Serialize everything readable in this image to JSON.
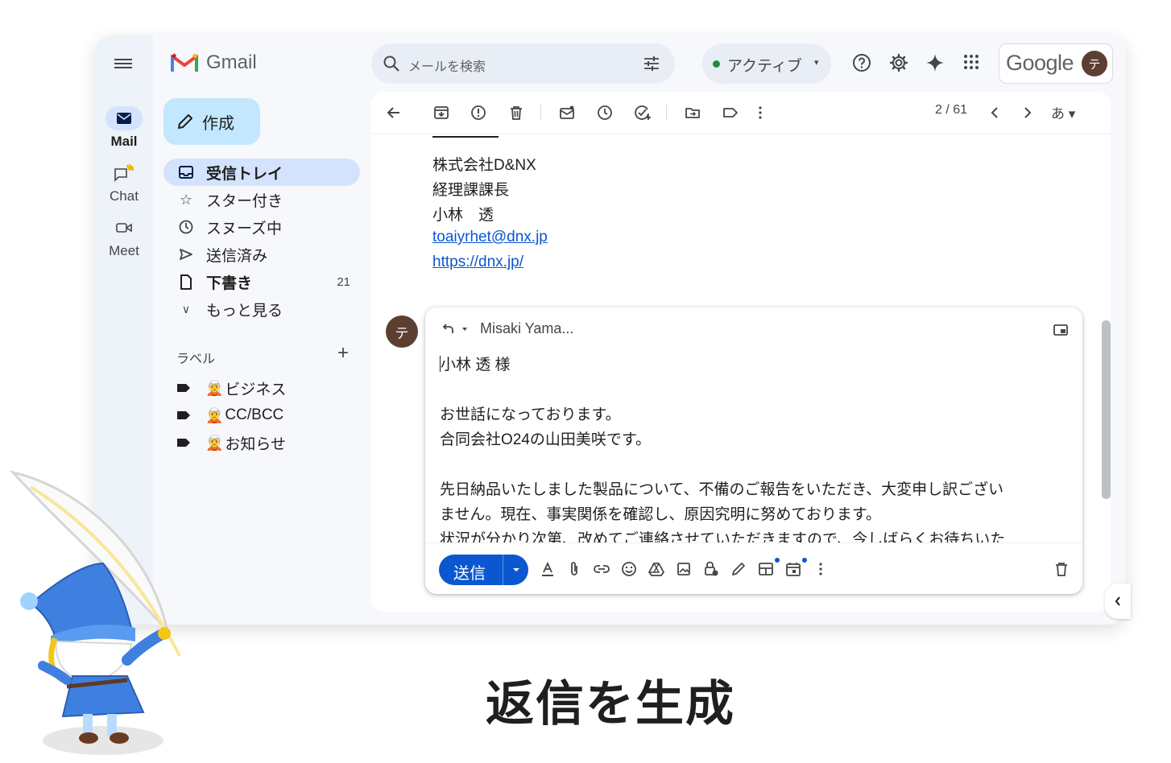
{
  "app": {
    "name": "Gmail",
    "brand_colors": {
      "blue": "#0b57d0",
      "compose": "#c2e7ff",
      "nav_active": "#d3e3fd",
      "avatar": "#5d3f32"
    }
  },
  "rail": {
    "items": [
      {
        "label": "Mail",
        "icon": "mail-icon",
        "active": true
      },
      {
        "label": "Chat",
        "icon": "chat-icon"
      },
      {
        "label": "Meet",
        "icon": "video-icon"
      }
    ]
  },
  "search": {
    "placeholder": "メールを検索"
  },
  "status": {
    "label": "アクティブ"
  },
  "account": {
    "brand": "Google",
    "initial": "テ"
  },
  "compose": {
    "label": "作成"
  },
  "nav": {
    "items": [
      {
        "label": "受信トレイ",
        "icon": "inbox-icon"
      },
      {
        "label": "スター付き",
        "icon": "star-icon"
      },
      {
        "label": "スヌーズ中",
        "icon": "clock-icon"
      },
      {
        "label": "送信済み",
        "icon": "send-icon"
      },
      {
        "label": "下書き",
        "icon": "draft-icon",
        "count": "21"
      },
      {
        "label": "もっと見る",
        "icon": "chevron-down-icon"
      }
    ]
  },
  "labels": {
    "heading": "ラベル",
    "items": [
      {
        "name": "ビジネス",
        "emoji": "🧝"
      },
      {
        "name": "CC/BCC",
        "emoji": "🧝"
      },
      {
        "name": "お知らせ",
        "emoji": "🧝"
      }
    ]
  },
  "toolbar": {
    "pager": "2 / 61",
    "input_lang": "あ"
  },
  "signature": {
    "dashes": "ーーーー",
    "company": "株式会社D&NX",
    "title": "経理課課長",
    "name": "小林　透",
    "email": "toaiyrhet@dnx.jp",
    "url": "https://dnx.jp/"
  },
  "reply": {
    "avatar_initial": "テ",
    "to": "Misaki Yama...",
    "body": {
      "line1": "小林 透 様",
      "line2": "お世話になっております。",
      "line3": "合同会社O24の山田美咲です。",
      "line4": "先日納品いたしました製品について、不備のご報告をいただき、大変申し訳ござい",
      "line5": "ません。現在、事実関係を確認し、原因究明に努めております。",
      "line6": "状況が分かり次第、改めてご連絡させていただきますので、今しばらくお待ちいた"
    },
    "send_label": "送信"
  },
  "caption": "返信を生成"
}
